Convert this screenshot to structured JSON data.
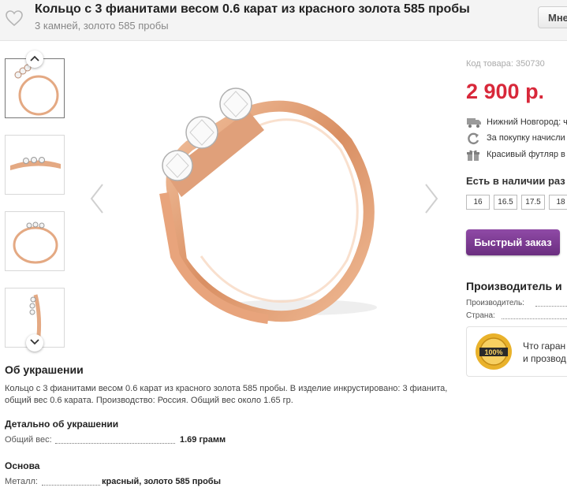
{
  "header": {
    "title": "Кольцо с 3 фианитами весом 0.6 карат из красного золота 585 пробы",
    "subtitle": "3 камней, золото 585 пробы",
    "more_button": "Мне"
  },
  "product": {
    "sku_label": "Код товара: 350730",
    "price": "2 900 р.",
    "info": [
      {
        "icon": "truck-icon",
        "text": "Нижний Новгород: ч"
      },
      {
        "icon": "refresh-icon",
        "text": "За покупку начисли"
      },
      {
        "icon": "gift-icon",
        "text": "Красивый футляр в"
      }
    ],
    "availability": "Есть в наличии раз",
    "sizes": [
      "16",
      "16.5",
      "17.5",
      "18"
    ],
    "quick_order": "Быстрый заказ"
  },
  "manufacturer": {
    "heading": "Производитель и",
    "rows": [
      "Производитель:",
      "Страна:"
    ],
    "guarantee_badge": "100%",
    "guarantee_line1": "Что гаран",
    "guarantee_line2": "и прозвод"
  },
  "description": {
    "heading": "Об украшении",
    "text": "Кольцо с 3 фианитами весом 0.6 карат из красного золота 585 пробы. В изделие инкрустировано: 3 фианита, общий вес 0.6 карата. Производство: Россия. Общий вес около 1.65 гр."
  },
  "details": {
    "heading": "Детально об украшении",
    "weight_label": "Общий вес:",
    "weight_value": "1.69 грамм"
  },
  "base": {
    "heading": "Основа",
    "metal_label": "Металл:",
    "metal_value": "красный, золото 585 пробы"
  },
  "colors": {
    "price": "#d8283a",
    "quick_order": "#7b3a92",
    "gold": "#e3a57f"
  }
}
